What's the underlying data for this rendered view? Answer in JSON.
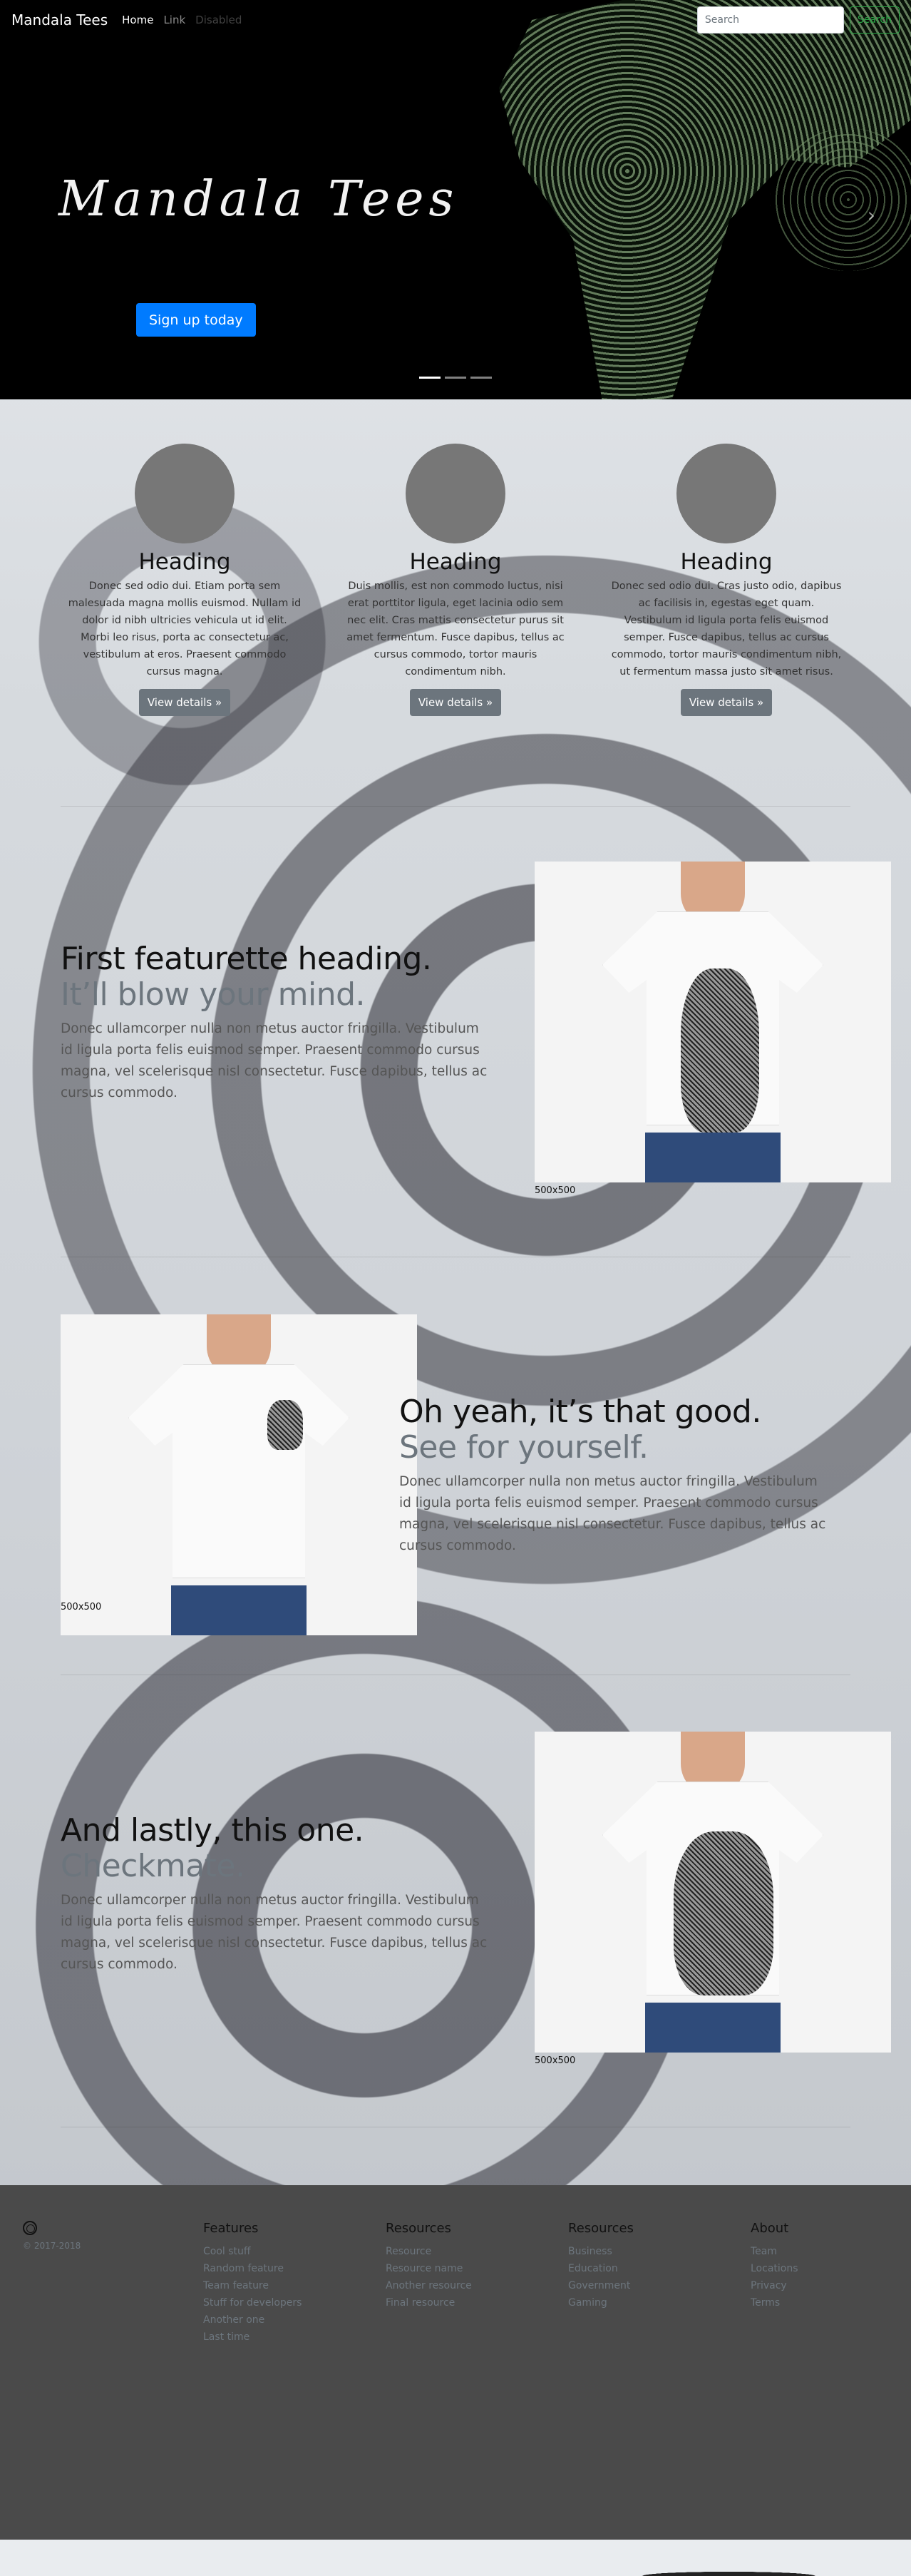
{
  "nav": {
    "brand": "Mandala Tees",
    "links": [
      {
        "label": "Home"
      },
      {
        "label": "Link"
      },
      {
        "label": "Disabled"
      }
    ],
    "search_placeholder": "Search",
    "search_button": "Search"
  },
  "hero": {
    "title": "Mandala Tees",
    "cta": "Sign up today",
    "next_glyph": "›",
    "slides": 3,
    "active_slide": 1
  },
  "marketing": [
    {
      "heading": "Heading",
      "text": "Donec sed odio dui. Etiam porta sem malesuada magna mollis euismod. Nullam id dolor id nibh ultricies vehicula ut id elit. Morbi leo risus, porta ac consectetur ac, vestibulum at eros. Praesent commodo cursus magna.",
      "button": "View details »"
    },
    {
      "heading": "Heading",
      "text": "Duis mollis, est non commodo luctus, nisi erat porttitor ligula, eget lacinia odio sem nec elit. Cras mattis consectetur purus sit amet fermentum. Fusce dapibus, tellus ac cursus commodo, tortor mauris condimentum nibh.",
      "button": "View details »"
    },
    {
      "heading": "Heading",
      "text": "Donec sed odio dui. Cras justo odio, dapibus ac facilisis in, egestas eget quam. Vestibulum id ligula porta felis euismod semper. Fusce dapibus, tellus ac cursus commodo, tortor mauris condimentum nibh, ut fermentum massa justo sit amet risus.",
      "button": "View details »"
    }
  ],
  "featurettes": [
    {
      "heading": "First featurette heading.",
      "muted": "It’ll blow your mind.",
      "text": "Donec ullamcorper nulla non metus auctor fringilla. Vestibulum id ligula porta felis euismod semper. Praesent commodo cursus magna, vel scelerisque nisl consectetur. Fusce dapibus, tellus ac cursus commodo.",
      "caption": "500x500"
    },
    {
      "heading": "Oh yeah, it’s that good.",
      "muted": "See for yourself.",
      "text": "Donec ullamcorper nulla non metus auctor fringilla. Vestibulum id ligula porta felis euismod semper. Praesent commodo cursus magna, vel scelerisque nisl consectetur. Fusce dapibus, tellus ac cursus commodo.",
      "caption": "500x500"
    },
    {
      "heading": "And lastly, this one.",
      "muted": "Checkmate.",
      "text": "Donec ullamcorper nulla non metus auctor fringilla. Vestibulum id ligula porta felis euismod semper. Praesent commodo cursus magna, vel scelerisque nisl consectetur. Fusce dapibus, tellus ac cursus commodo.",
      "caption": "500x500"
    }
  ],
  "footer": {
    "copyright": "© 2017-2018",
    "columns": [
      {
        "title": "Features",
        "links": [
          "Cool stuff",
          "Random feature",
          "Team feature",
          "Stuff for developers",
          "Another one",
          "Last time"
        ]
      },
      {
        "title": "Resources",
        "links": [
          "Resource",
          "Resource name",
          "Another resource",
          "Final resource"
        ]
      },
      {
        "title": "Resources",
        "links": [
          "Business",
          "Education",
          "Government",
          "Gaming"
        ]
      },
      {
        "title": "About",
        "links": [
          "Team",
          "Locations",
          "Privacy",
          "Terms"
        ]
      }
    ]
  },
  "colors": {
    "primary": "#007bff",
    "secondary": "#6c757d",
    "success": "#28a745",
    "footer_bg": "#4a4a4a"
  }
}
